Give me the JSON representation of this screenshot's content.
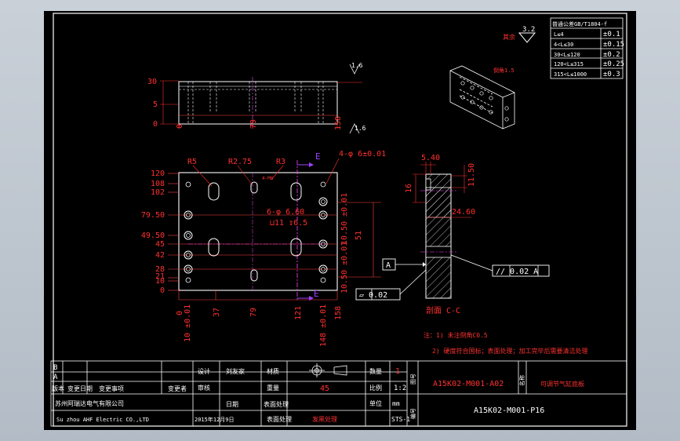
{
  "colors": {
    "background": "#b8c0c9",
    "sheet": "#000000",
    "outline": "#ffffff",
    "dimension": "#ff2020",
    "centerline": "#ff40ff",
    "section_arrow": "#a040ff",
    "title_red": "#ff3030",
    "title_white": "#ffffff"
  },
  "surface": {
    "general_symbol_value": "3.2",
    "general_label": "其余",
    "callout_top": "1.6",
    "callout_bottom": "1.6",
    "iso_note": "倒角1.5"
  },
  "tolerance_table": {
    "title": "普通公差GB/T1804-f",
    "rows": [
      {
        "range": "L≤4",
        "value": "±0.1"
      },
      {
        "range": "4<L≤30",
        "value": "±0.15"
      },
      {
        "range": "30<L≤120",
        "value": "±0.2"
      },
      {
        "range": "120<L≤315",
        "value": "±0.25"
      },
      {
        "range": "315<L≤1000",
        "value": "±0.3"
      }
    ]
  },
  "top_view": {
    "dims_left": [
      "30",
      "5",
      "0"
    ],
    "dims_bottom": [
      "0",
      "79",
      "158"
    ]
  },
  "front_view": {
    "dims_left": [
      "120",
      "108",
      "102",
      "79.50",
      "49.50",
      "45",
      "42",
      "28",
      "21",
      "10",
      "0"
    ],
    "dims_bottom": [
      "0",
      "37",
      "79",
      "121",
      "158"
    ],
    "tol_bottom_1": "10 ±0.01",
    "tol_bottom_2": "148 ±0.01",
    "tol_right_1": "10.50 ±0.01",
    "tol_right_2": "10.50 ±0.01",
    "dim_51": "51",
    "holes_note": "4-φ 6±0.01",
    "thread_note": "6-φ 6.60",
    "cbore_note": "⊔11 ↧6.5",
    "thread_small": "4-M6",
    "r5": "R5",
    "r275": "R2.75",
    "r3": "R3",
    "section_mark_top": "E",
    "section_mark_bottom": "E"
  },
  "section_view": {
    "dim_top": "5.40",
    "dim_right": "11.50",
    "dim_left": "16",
    "dim_mid": "24.60",
    "datum": "A",
    "parallel_tol": "// 0.02 A",
    "flat_tol": "▱ 0.02",
    "label": "剖面 C-C"
  },
  "notes": [
    "注：1) 未注倒角C0.5",
    "2) 硬度符合国标；表面处理；加工完毕后需要清洁处理"
  ],
  "title_block": {
    "rev_rows": [
      "B",
      "A"
    ],
    "headers": [
      "版本",
      "变更日期",
      "变更事项",
      "",
      "变更者"
    ],
    "design_label": "设计",
    "design_person": "刘友家",
    "check_label": "审核",
    "date_label": "日期",
    "date_value": "2015年12月9日",
    "material_label": "材质",
    "weight_label": "重量",
    "surface_label": "表面处理",
    "surface_value": "发黑处理",
    "hardness_value": "45",
    "qty_label": "数量",
    "qty_value": "1",
    "scale_label": "比例",
    "scale_value": "1:2",
    "unit_label": "单位",
    "unit_value": "mm",
    "code_value": "STS-1",
    "company_cn": "苏州阿瑞达电气有限公司",
    "company_en": "Su zhou AHF Electric CO.,LTD",
    "drawing_no_label": "图号",
    "drawing_no": "A15K02-M001-A02",
    "part_name_label": "名称",
    "part_name": "可调节气缸底板",
    "part_no_label": "编号",
    "part_no": "A15K02-M001-P16"
  }
}
